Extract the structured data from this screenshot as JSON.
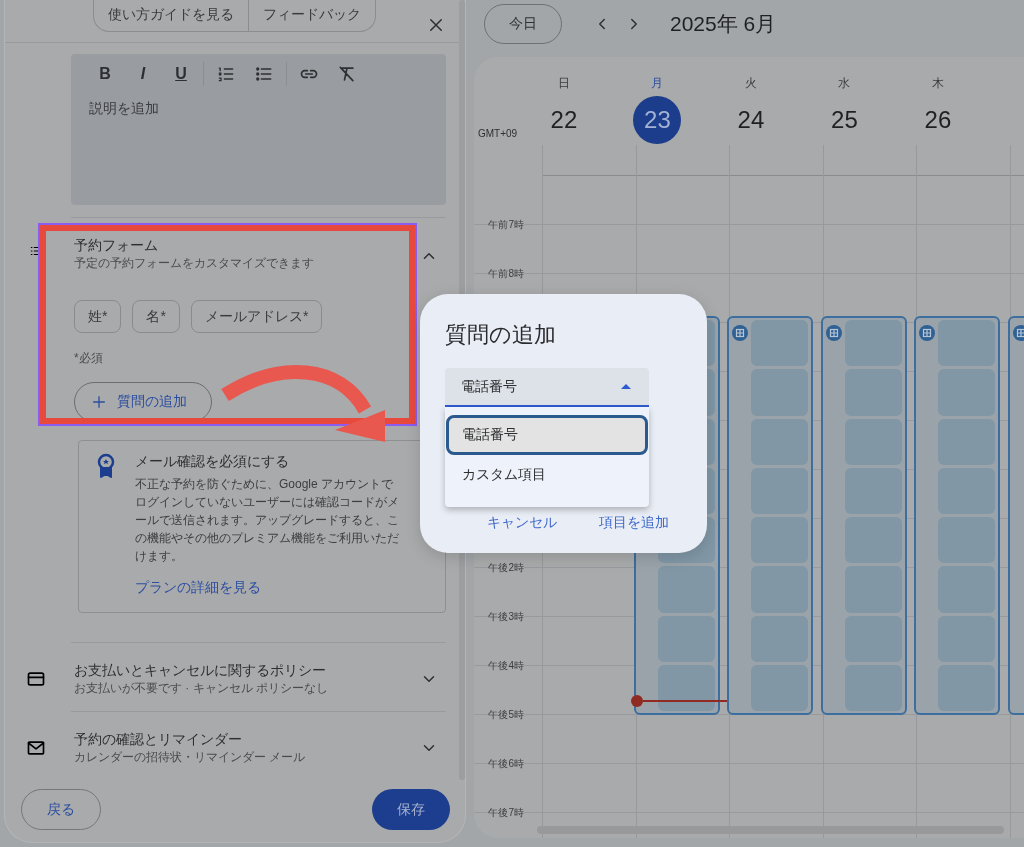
{
  "panel": {
    "header_buttons": [
      "使い方ガイドを見る",
      "フィードバック"
    ],
    "editor": {
      "toolbar": [
        {
          "kind": "bold",
          "glyph": "B"
        },
        {
          "kind": "italic",
          "glyph": "I"
        },
        {
          "kind": "underline",
          "glyph": "U"
        },
        {
          "kind": "separator"
        },
        {
          "kind": "numbered_list"
        },
        {
          "kind": "bulleted_list"
        },
        {
          "kind": "separator"
        },
        {
          "kind": "link"
        },
        {
          "kind": "clear_format"
        }
      ],
      "placeholder": "説明を追加"
    },
    "form_section": {
      "title": "予約フォーム",
      "subtitle": "予定の予約フォームをカスタマイズできます",
      "expanded": true,
      "chips": [
        "姓*",
        "名*",
        "メールアドレス*"
      ],
      "note": "*必須",
      "add_button": "質問の追加"
    },
    "notice": {
      "title": "メール確認を必須にする",
      "body": "不正な予約を防ぐために、Google アカウントでログインしていないユーザーには確認コードがメールで送信されます。アップグレードすると、この機能やその他のプレミアム機能をご利用いただけます。",
      "link": "プランの詳細を見る"
    },
    "sections": [
      {
        "kind": "payment",
        "title": "お支払いとキャンセルに関するポリシー",
        "subtitle": "お支払いが不要です · キャンセル ポリシーなし",
        "expanded": false
      },
      {
        "kind": "mail",
        "title": "予約の確認とリマインダー",
        "subtitle": "カレンダーの招待状・リマインダー メール",
        "expanded": false
      }
    ],
    "footer": {
      "back": "戻る",
      "save": "保存"
    }
  },
  "calendar": {
    "today_button": "今日",
    "title": "2025年 6月",
    "timezone": "GMT+09",
    "days": [
      {
        "weekday": "日",
        "date": "22",
        "today": false,
        "block": false,
        "now_line": false
      },
      {
        "weekday": "月",
        "date": "23",
        "today": true,
        "block": true,
        "block_icon": false,
        "now_line": true
      },
      {
        "weekday": "火",
        "date": "24",
        "today": false,
        "block": true,
        "block_icon": true,
        "now_line": false
      },
      {
        "weekday": "水",
        "date": "25",
        "today": false,
        "block": true,
        "block_icon": true,
        "now_line": false
      },
      {
        "weekday": "木",
        "date": "26",
        "today": false,
        "block": true,
        "block_icon": true,
        "now_line": false
      },
      {
        "block": true,
        "block_icon": true,
        "now_line": false
      }
    ],
    "hours": [
      {
        "kind": "blank"
      },
      {
        "kind": "label",
        "label": "午前7時"
      },
      {
        "kind": "label",
        "label": "午前8時"
      },
      {
        "kind": "blank"
      },
      {
        "kind": "blank"
      },
      {
        "kind": "blank"
      },
      {
        "kind": "blank"
      },
      {
        "kind": "blank"
      },
      {
        "kind": "label",
        "label": "午後2時"
      },
      {
        "kind": "label",
        "label": "午後3時"
      },
      {
        "kind": "label",
        "label": "午後4時"
      },
      {
        "kind": "label",
        "label": "午後5時"
      },
      {
        "kind": "label",
        "label": "午後6時"
      },
      {
        "kind": "label",
        "label": "午後7時"
      }
    ]
  },
  "dialog": {
    "title": "質問の追加",
    "select": {
      "value": "電話番号",
      "expanded": true
    },
    "options": [
      {
        "label": "電話番号",
        "selected": true
      },
      {
        "label": "カスタム項目",
        "selected": false
      }
    ],
    "buttons": [
      "キャンセル",
      "項目を追加"
    ]
  },
  "annotations": {
    "highlight_frame": true,
    "arrow": true
  }
}
